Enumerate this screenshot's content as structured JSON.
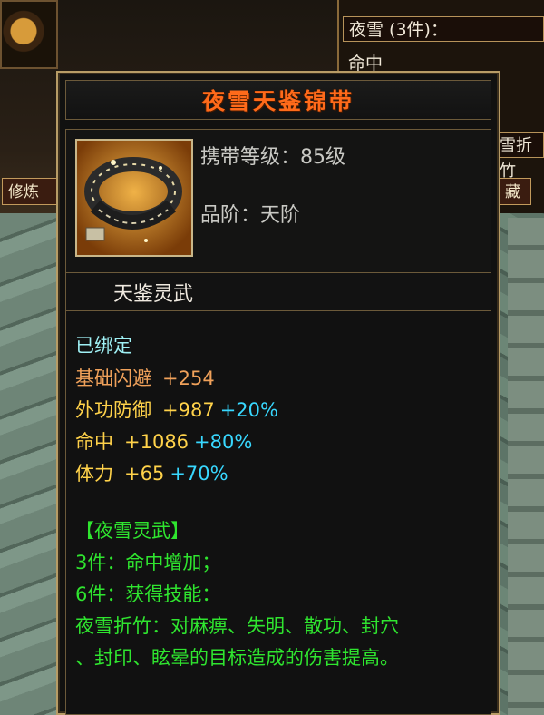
{
  "background": {
    "set_row_title": "夜雪 (3件)：",
    "set_row_stat": "命中",
    "set_row_skill": "雪折竹",
    "left_tab": "修炼",
    "right_tab": "藏"
  },
  "tooltip": {
    "title": "夜雪天鉴锦带",
    "header": {
      "carry_level": "携带等级：85级",
      "grade": "品阶：天阶",
      "icon": "belt-icon"
    },
    "subtitle": "天鉴灵武",
    "bound": "已绑定",
    "stats": [
      {
        "name": "基础闪避",
        "value": "+254",
        "bonus": ""
      },
      {
        "name": "外功防御",
        "value": "+987",
        "bonus": "+20%"
      },
      {
        "name": "命中",
        "value": "+1086",
        "bonus": "+80%"
      },
      {
        "name": "体力",
        "value": "+65",
        "bonus": "+70%"
      }
    ],
    "set_name": "【夜雪灵武】",
    "set_bonus_3": "3件：命中增加；",
    "set_bonus_6": "6件：获得技能：",
    "skill_line1": "夜雪折竹：对麻痹、失明、散功、封穴",
    "skill_line2": "、封印、眩晕的目标造成的伤害提高。"
  },
  "colors": {
    "title": "#ff6a1a",
    "bound": "#9ff0f4",
    "stat_name_base": "#f0a15a",
    "stat_name_gold": "#ffd24a",
    "bonus_pct": "#38d8ff",
    "set_green": "#2fe52f"
  }
}
